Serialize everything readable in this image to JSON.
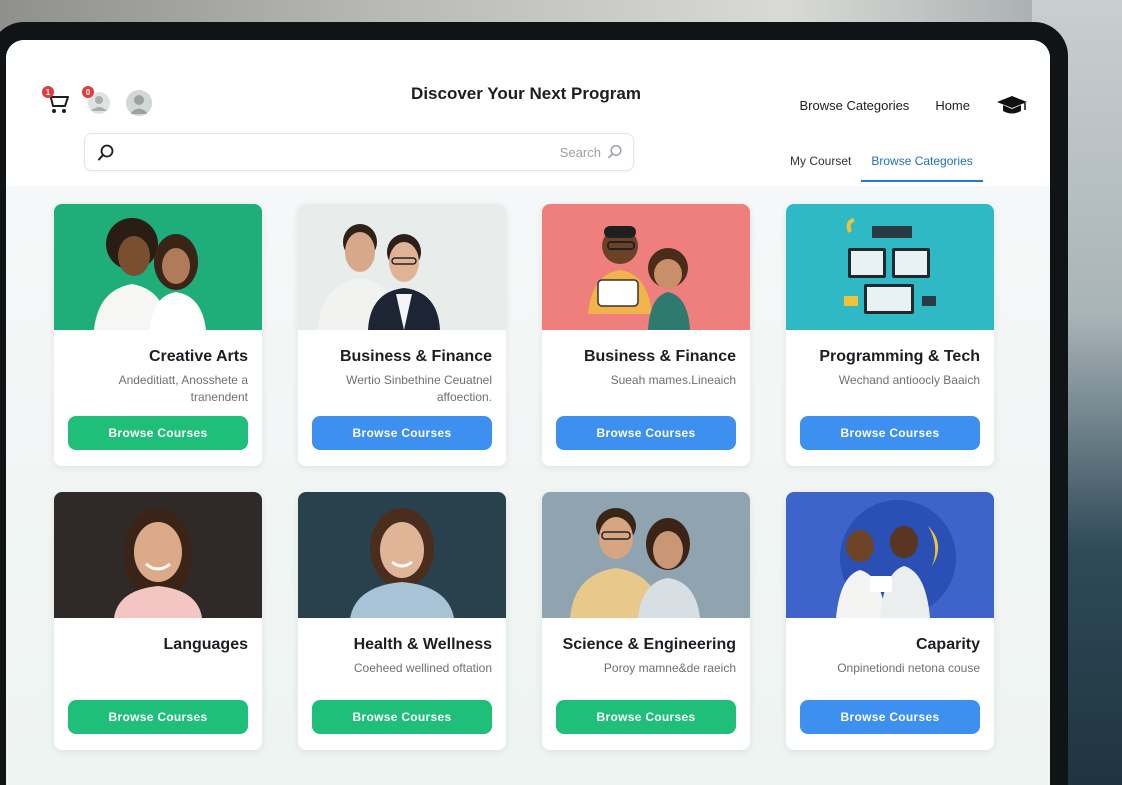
{
  "header": {
    "title": "Discover Your Next Program",
    "nav": {
      "home": "Home",
      "browse": "Browse Categories"
    },
    "cart_badge": "1",
    "bell_badge": "0"
  },
  "search": {
    "placeholder": "Search"
  },
  "tabs": [
    {
      "label": "Browse Categories",
      "active": true
    },
    {
      "label": "My Courset",
      "active": false
    }
  ],
  "colors": {
    "accent_blue": "#3d8ff0",
    "accent_green": "#1fbf7a",
    "tab_active": "#2a78c8"
  },
  "cards": [
    {
      "title": "Creative Arts",
      "desc": "Andeditiatt, Anosshete a tranendent",
      "button": "Browse Courses",
      "button_color": "green"
    },
    {
      "title": "Business & Finance",
      "desc": "Wertio Sinbethine Ceuatnel affoection.",
      "button": "Browse Courses",
      "button_color": "blue"
    },
    {
      "title": "Business & Finance",
      "desc": "Sueah mames.Lineaich",
      "button": "Browse Courses",
      "button_color": "blue"
    },
    {
      "title": "Programming & Tech",
      "desc": "Wechand antioocly Baaich",
      "button": "Browse Courses",
      "button_color": "blue"
    },
    {
      "title": "Languages",
      "desc": "",
      "button": "Browse Courses",
      "button_color": "green"
    },
    {
      "title": "Health & Wellness",
      "desc": "Coeheed wellined oftation",
      "button": "Browse Courses",
      "button_color": "green"
    },
    {
      "title": "Science & Engineering",
      "desc": "Poroy mamne&de raeich",
      "button": "Browse Courses",
      "button_color": "green"
    },
    {
      "title": "Caparity",
      "desc": "Onpinetiondi netona couse",
      "button": "Browse Courses",
      "button_color": "blue"
    }
  ]
}
